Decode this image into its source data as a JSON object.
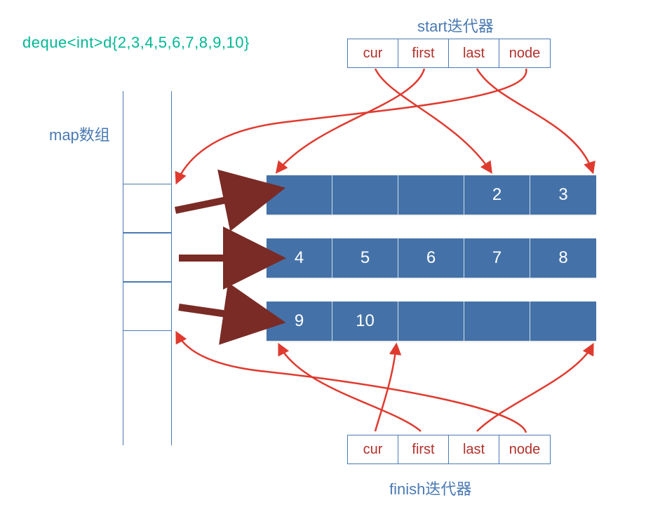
{
  "declaration": "deque<int>d{2,3,4,5,6,7,8,9,10}",
  "labels": {
    "start_iterator": "start迭代器",
    "finish_iterator": "finish迭代器",
    "map_array": "map数组"
  },
  "iterator_fields": {
    "cur": "cur",
    "first": "first",
    "last": "last",
    "node": "node"
  },
  "map_slots": 3,
  "buffers": [
    {
      "cells": [
        "",
        "",
        "",
        "2",
        "3"
      ]
    },
    {
      "cells": [
        "4",
        "5",
        "6",
        "7",
        "8"
      ]
    },
    {
      "cells": [
        "9",
        "10",
        "",
        "",
        ""
      ]
    }
  ],
  "chart_data": {
    "type": "table",
    "title": "deque<int> internal layout",
    "buffer_size": 5,
    "map_entries": [
      0,
      1,
      2
    ],
    "buffers": [
      {
        "index": 0,
        "values": [
          null,
          null,
          null,
          2,
          3
        ]
      },
      {
        "index": 1,
        "values": [
          4,
          5,
          6,
          7,
          8
        ]
      },
      {
        "index": 2,
        "values": [
          9,
          10,
          null,
          null,
          null
        ]
      }
    ],
    "start_iterator": {
      "node_map_index": 0,
      "first_buffer_index": 0,
      "cur_buffer_index": 3,
      "cur_value": 2,
      "last_buffer_index": 5
    },
    "finish_iterator": {
      "node_map_index": 2,
      "first_buffer_index": 0,
      "cur_buffer_index": 2,
      "last_buffer_index": 5
    }
  },
  "colors": {
    "buffer_fill": "#4472a8",
    "border": "#4a7ab3",
    "text_green": "#00b894",
    "text_red": "#b2302a",
    "arrow_red": "#e03a2f",
    "arrow_dark": "#7a2b25"
  }
}
